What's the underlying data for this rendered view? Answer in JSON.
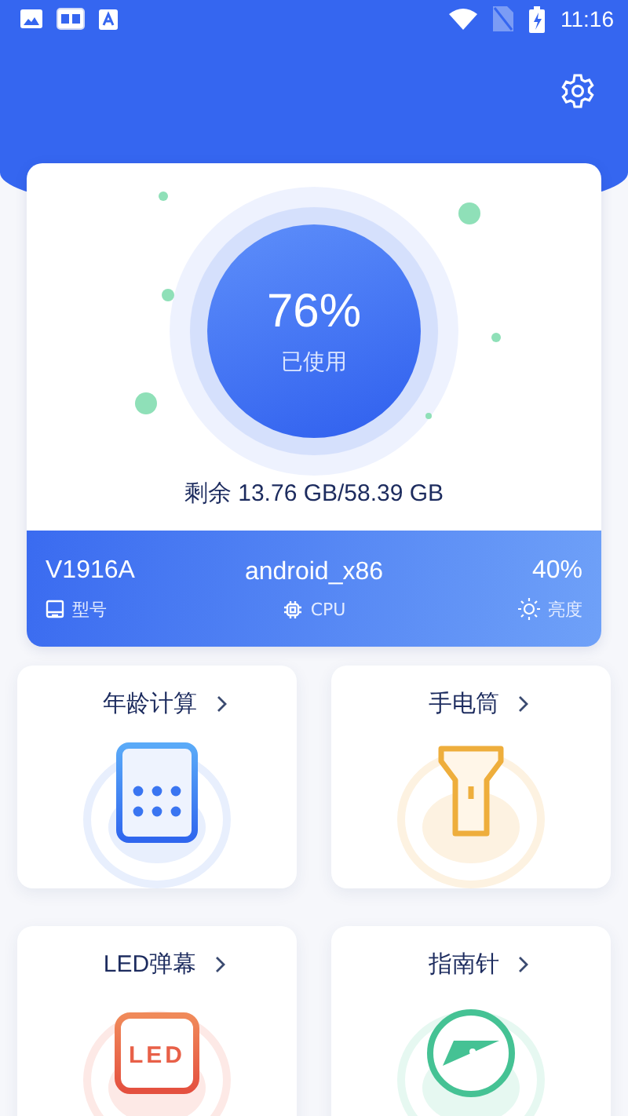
{
  "status_bar": {
    "time": "11:16"
  },
  "storage": {
    "percent": "76%",
    "caption": "已使用",
    "remaining": "剩余 13.76 GB/58.39 GB"
  },
  "device_info": [
    {
      "kind": "model",
      "value": "V1916A",
      "label": "型号"
    },
    {
      "kind": "cpu",
      "value": "android_x86",
      "label": "CPU"
    },
    {
      "kind": "brightness",
      "value": "40%",
      "label": "亮度"
    }
  ],
  "tools": [
    {
      "kind": "calculator",
      "title": "年龄计算"
    },
    {
      "kind": "flashlight",
      "title": "手电筒"
    },
    {
      "kind": "led",
      "title": "LED弹幕",
      "icon_text": "LED"
    },
    {
      "kind": "compass",
      "title": "指南针"
    }
  ]
}
